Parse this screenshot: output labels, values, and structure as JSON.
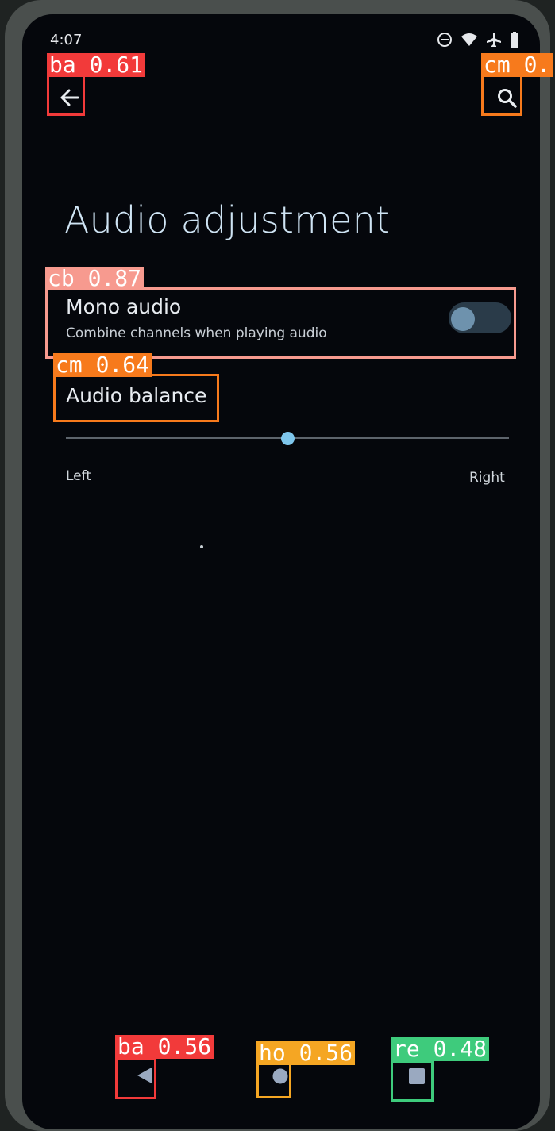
{
  "status_bar": {
    "time": "4:07"
  },
  "header": {
    "back_icon": "arrow-left-icon",
    "search_icon": "search-icon"
  },
  "page": {
    "title": "Audio adjustment"
  },
  "mono_audio": {
    "title": "Mono audio",
    "summary": "Combine channels when playing audio",
    "enabled": false
  },
  "audio_balance": {
    "title": "Audio balance",
    "left_label": "Left",
    "right_label": "Right",
    "value": 0.5
  },
  "nav_bar": {
    "back_icon": "triangle-back-icon",
    "home_icon": "circle-home-icon",
    "recents_icon": "square-recents-icon"
  },
  "detections": [
    {
      "label": "ba 0.61",
      "color": "#f23a3a"
    },
    {
      "label": "cm 0.",
      "color": "#f77a1c"
    },
    {
      "label": "cb 0.87",
      "color": "#f79a8f"
    },
    {
      "label": "cm 0.64",
      "color": "#f77a1c"
    },
    {
      "label": "ba 0.56",
      "color": "#f23a3a"
    },
    {
      "label": "ho 0.56",
      "color": "#f5a623"
    },
    {
      "label": "re 0.48",
      "color": "#3ecb7c"
    }
  ]
}
